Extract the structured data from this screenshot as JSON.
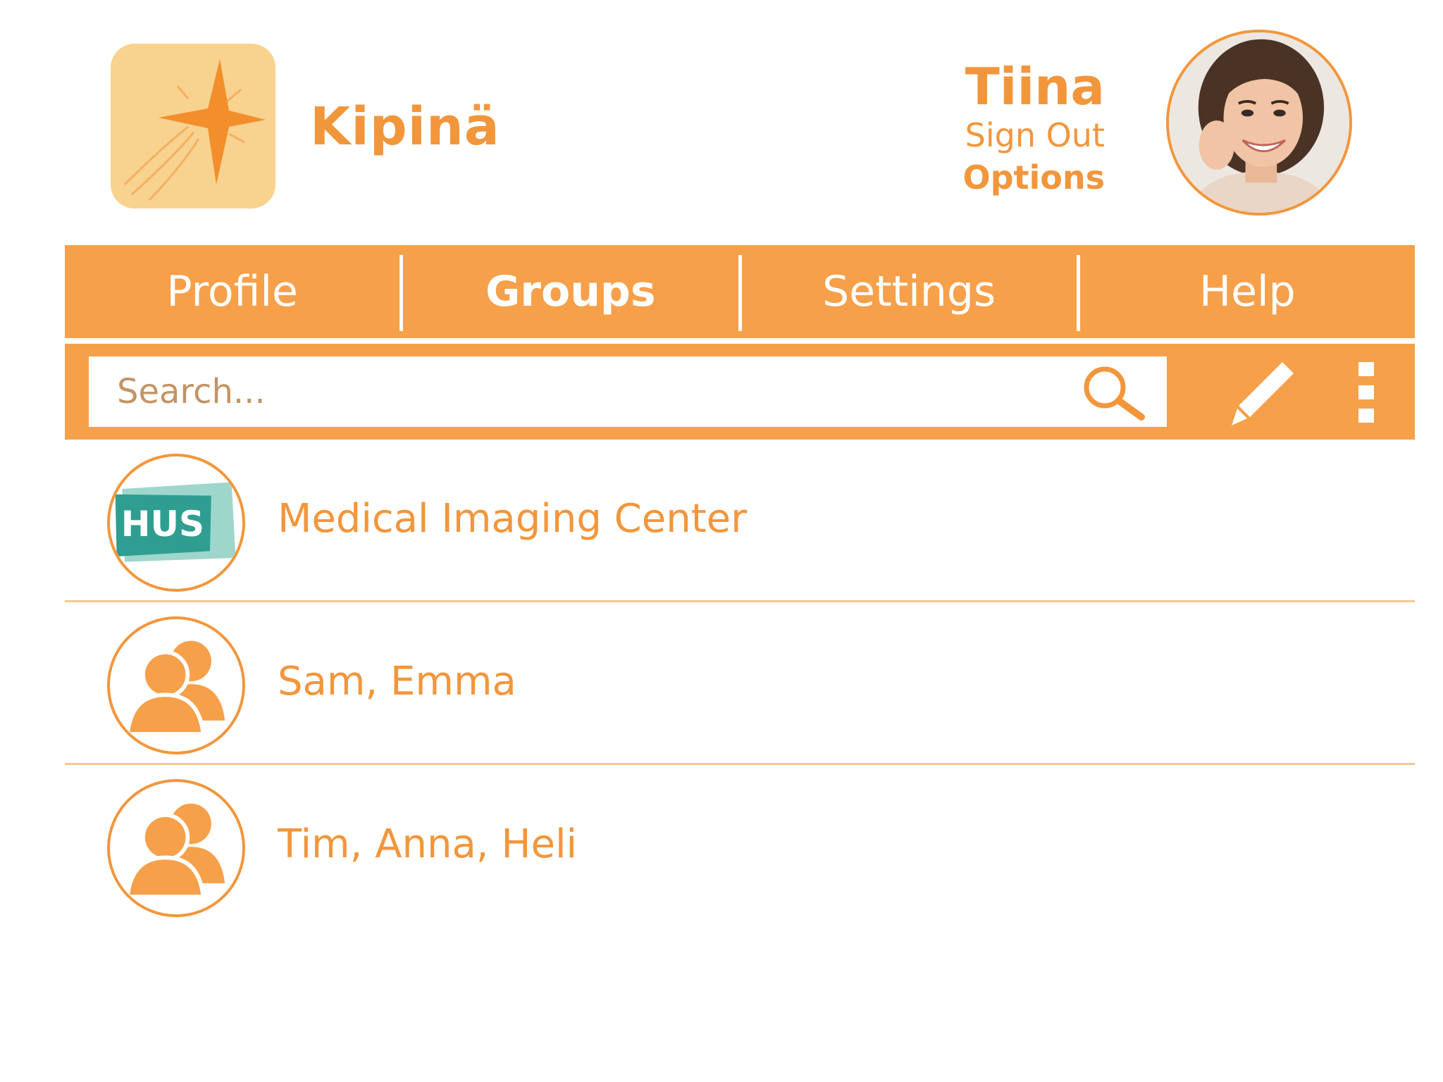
{
  "app": {
    "name": "Kipinä",
    "logo_icon": "sparkle-star-icon",
    "accent_color": "#f6a04a",
    "text_color": "#f2963c"
  },
  "user": {
    "name": "Tiina",
    "sign_out_label": "Sign Out",
    "options_label": "Options"
  },
  "tabs": [
    {
      "label": "Profile",
      "active": false
    },
    {
      "label": "Groups",
      "active": true
    },
    {
      "label": "Settings",
      "active": false
    },
    {
      "label": "Help",
      "active": false
    }
  ],
  "search": {
    "placeholder": "Search...",
    "value": "",
    "icon": "search-icon"
  },
  "toolbar": {
    "edit_icon": "pencil-icon",
    "more_icon": "more-vertical-icon"
  },
  "groups": [
    {
      "name": "Medical Imaging Center",
      "avatar": "organization-logo",
      "logo_text": "HUS"
    },
    {
      "name": "Sam, Emma",
      "avatar": "group-people-icon"
    },
    {
      "name": "Tim, Anna, Heli",
      "avatar": "group-people-icon"
    }
  ]
}
